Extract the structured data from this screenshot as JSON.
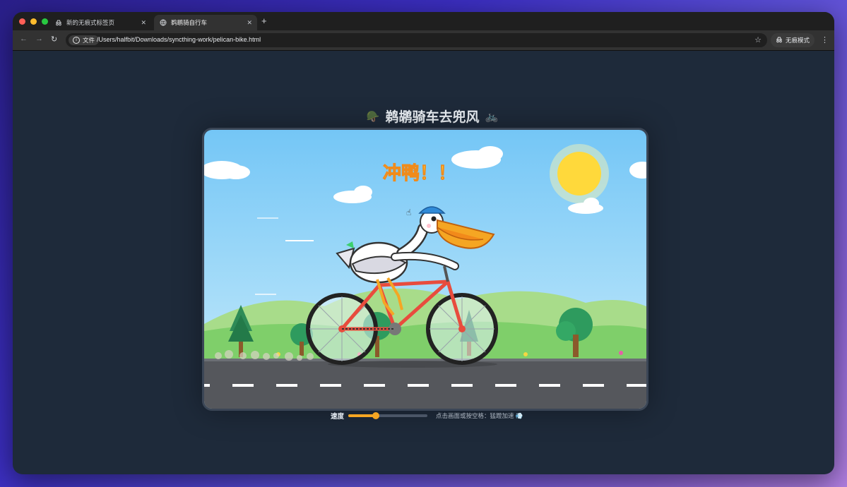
{
  "tabs": [
    {
      "label": "新的无痕式标签页",
      "icon": "incognito-icon"
    },
    {
      "label": "鹈鹕骑自行车",
      "icon": "globe-icon"
    }
  ],
  "toolbar": {
    "security_chip": "文件",
    "url": "/Users/halfbit/Downloads/syncthing-work/pelican-bike.html",
    "incognito_label": "无痕模式"
  },
  "page": {
    "title": "鹈鹕骑车去兜风",
    "title_emoji_left": "🪖",
    "title_emoji_right": "🚲",
    "scene_shout": "冲鸭！！",
    "speed_label": "速度",
    "speed_value": 0.35,
    "hint": "点击画面或按空格：猛蹬加速 💨"
  },
  "colors": {
    "sky": "#6ec6f5",
    "sun": "#ffd93b",
    "hill": "#a8dc8a",
    "grass": "#7fcf6a",
    "road": "#55575c",
    "frame": "#e84c3d",
    "accent": "#f5a623"
  }
}
